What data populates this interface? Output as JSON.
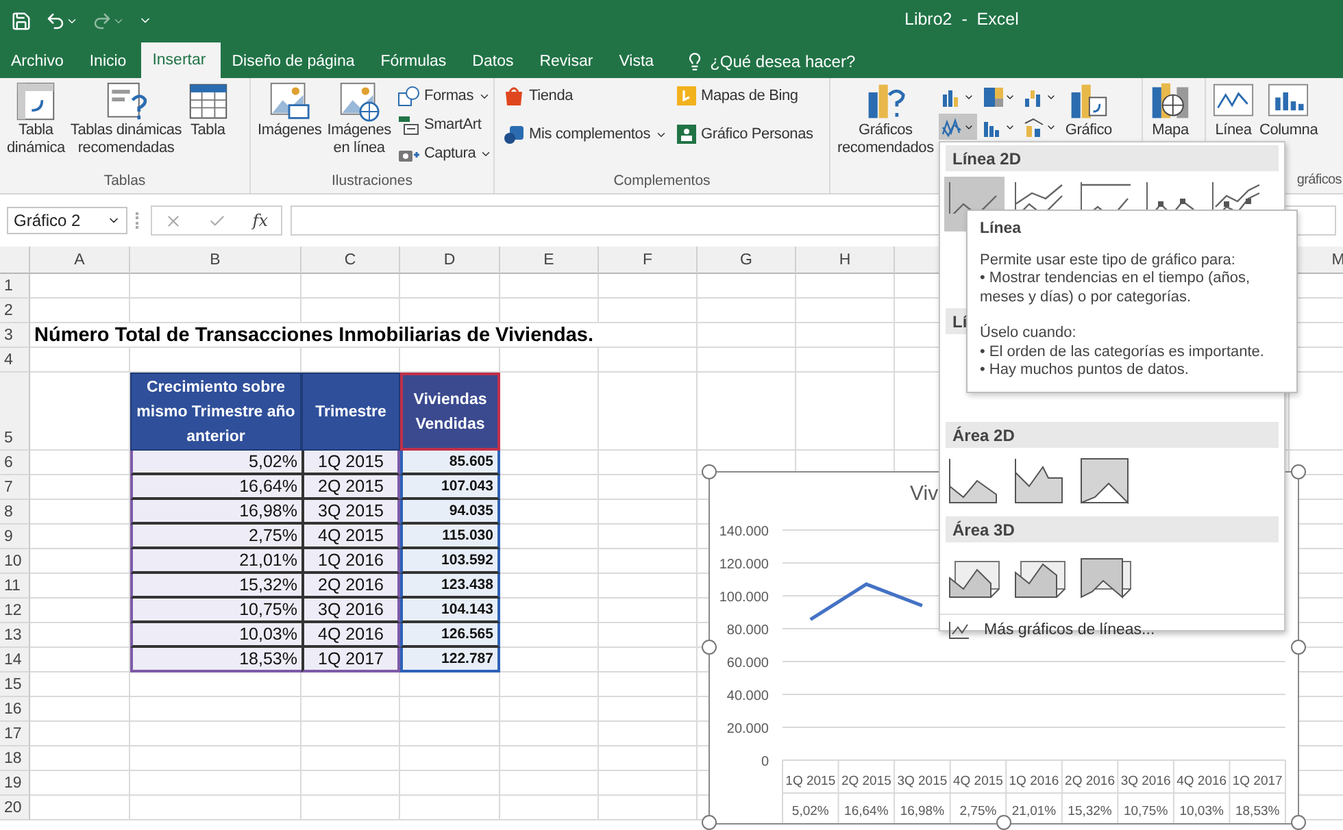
{
  "window": {
    "title": "Libro2  -  Excel"
  },
  "tabs": [
    {
      "label": "Archivo",
      "selected": false
    },
    {
      "label": "Inicio",
      "selected": false
    },
    {
      "label": "Insertar",
      "selected": true
    },
    {
      "label": "Diseño de página",
      "selected": false
    },
    {
      "label": "Fórmulas",
      "selected": false
    },
    {
      "label": "Datos",
      "selected": false
    },
    {
      "label": "Revisar",
      "selected": false
    },
    {
      "label": "Vista",
      "selected": false
    }
  ],
  "tell_me": "¿Qué desea hacer?",
  "ribbon": {
    "groups": [
      {
        "label": "Tablas",
        "items": [
          {
            "kind": "large",
            "label": "Tabla\ndinámica"
          },
          {
            "kind": "large",
            "label": "Tablas dinámicas\nrecomendadas"
          },
          {
            "kind": "large",
            "label": "Tabla"
          }
        ]
      },
      {
        "label": "Ilustraciones",
        "items": [
          {
            "kind": "large",
            "label": "Imágenes"
          },
          {
            "kind": "large",
            "label": "Imágenes\nen línea"
          },
          {
            "kind": "small",
            "label": "Formas",
            "has_menu": true
          },
          {
            "kind": "small",
            "label": "SmartArt",
            "has_menu": false
          },
          {
            "kind": "small",
            "label": "Captura",
            "has_menu": true
          }
        ]
      },
      {
        "label": "Complementos",
        "items": [
          {
            "kind": "small",
            "label": "Tienda",
            "has_menu": false
          },
          {
            "kind": "small",
            "label": "Mis complementos",
            "has_menu": true
          },
          {
            "kind": "small",
            "label": "Mapas de Bing",
            "has_menu": false
          },
          {
            "kind": "small",
            "label": "Gráfico Personas",
            "has_menu": false
          }
        ]
      },
      {
        "items": [
          {
            "kind": "large",
            "label": "Gráficos\nrecomendados"
          },
          {
            "kind": "chart_grid",
            "buttons": [
              {
                "selected": false
              },
              {
                "selected": false
              },
              {
                "selected": false
              },
              {
                "selected": true
              },
              {
                "selected": false
              },
              {
                "selected": false
              }
            ]
          },
          {
            "kind": "large",
            "label": "Gráfico"
          }
        ]
      },
      {
        "items": [
          {
            "kind": "large",
            "label": "Mapa"
          }
        ]
      },
      {
        "label": "gráficos",
        "items": [
          {
            "kind": "large",
            "label": "Línea"
          },
          {
            "kind": "large",
            "label": "Columna"
          }
        ]
      }
    ]
  },
  "formula_bar": {
    "name_box": "Gráfico 2",
    "function_label": "fx"
  },
  "sheet": {
    "columns": [
      "A",
      "B",
      "C",
      "D",
      "E",
      "F",
      "G",
      "H"
    ],
    "last_column": "M",
    "row_numbers": [
      "1",
      "2",
      "3",
      "4",
      "5",
      "6",
      "7",
      "8",
      "9",
      "10",
      "11",
      "12",
      "13",
      "14",
      "15",
      "16",
      "17",
      "18",
      "19",
      "20"
    ],
    "title": "Número Total de Transacciones Inmobiliarias de Viviendas.",
    "table": {
      "headers": [
        "Crecimiento sobre mismo Trimestre año anterior",
        "Trimestre",
        "Viviendas Vendidas"
      ],
      "rows": [
        {
          "growth": "5,02%",
          "quarter": "1Q 2015",
          "sold": "85.605"
        },
        {
          "growth": "16,64%",
          "quarter": "2Q 2015",
          "sold": "107.043"
        },
        {
          "growth": "16,98%",
          "quarter": "3Q 2015",
          "sold": "94.035"
        },
        {
          "growth": "2,75%",
          "quarter": "4Q 2015",
          "sold": "115.030"
        },
        {
          "growth": "21,01%",
          "quarter": "1Q 2016",
          "sold": "103.592"
        },
        {
          "growth": "15,32%",
          "quarter": "2Q 2016",
          "sold": "123.438"
        },
        {
          "growth": "10,75%",
          "quarter": "3Q 2016",
          "sold": "104.143"
        },
        {
          "growth": "10,03%",
          "quarter": "4Q 2016",
          "sold": "126.565"
        },
        {
          "growth": "18,53%",
          "quarter": "1Q 2017",
          "sold": "122.787"
        }
      ]
    }
  },
  "chart": {
    "title": "Viv",
    "secondary_categories": [
      "5,02%",
      "16,64%",
      "16,98%",
      "2,75%",
      "21,01%",
      "15,32%",
      "10,75%",
      "10,03%",
      "18,53%"
    ],
    "chart_data": {
      "type": "line",
      "categories": [
        "1Q 2015",
        "2Q 2015",
        "3Q 2015",
        "4Q 2015",
        "1Q 2016",
        "2Q 2016",
        "3Q 2016",
        "4Q 2016",
        "1Q 2017"
      ],
      "series": [
        {
          "color": "#4472c4",
          "values": [
            85605,
            107043,
            94035,
            null,
            null,
            null,
            null,
            null,
            null
          ]
        }
      ],
      "ylim": [
        0,
        140000
      ],
      "grid": true,
      "yticks": [
        {
          "value": 0,
          "label": "0"
        },
        {
          "value": 20000,
          "label": "20.000"
        },
        {
          "value": 40000,
          "label": "40.000"
        },
        {
          "value": 60000,
          "label": "60.000"
        },
        {
          "value": 80000,
          "label": "80.000"
        },
        {
          "value": 100000,
          "label": "100.000"
        },
        {
          "value": 120000,
          "label": "120.000"
        },
        {
          "value": 140000,
          "label": "140.000"
        }
      ]
    }
  },
  "gallery": {
    "sections": [
      {
        "label": "Línea 2D",
        "options": [
          {
            "selected": true
          },
          {
            "selected": false
          },
          {
            "selected": false
          },
          {
            "selected": false
          },
          {
            "selected": false
          }
        ]
      },
      {
        "label": "Lí"
      },
      {
        "label": "Área 2D",
        "options": [
          {
            "selected": false
          },
          {
            "selected": false
          },
          {
            "selected": false
          }
        ]
      },
      {
        "label": "Área 3D",
        "options": [
          {
            "selected": false
          },
          {
            "selected": false
          },
          {
            "selected": false
          }
        ]
      }
    ],
    "more": "Más gráficos de líneas..."
  },
  "tooltip": {
    "title": "Línea",
    "paragraphs": [
      {
        "lead": "Permite usar este tipo de gráfico para:",
        "bullets": [
          "• Mostrar tendencias en el tiempo (años, meses y días) o por categorías."
        ]
      },
      {
        "lead": "Úselo cuando:",
        "bullets": [
          "• El orden de las categorías es importante.",
          "• Hay muchos puntos de datos."
        ]
      }
    ]
  }
}
